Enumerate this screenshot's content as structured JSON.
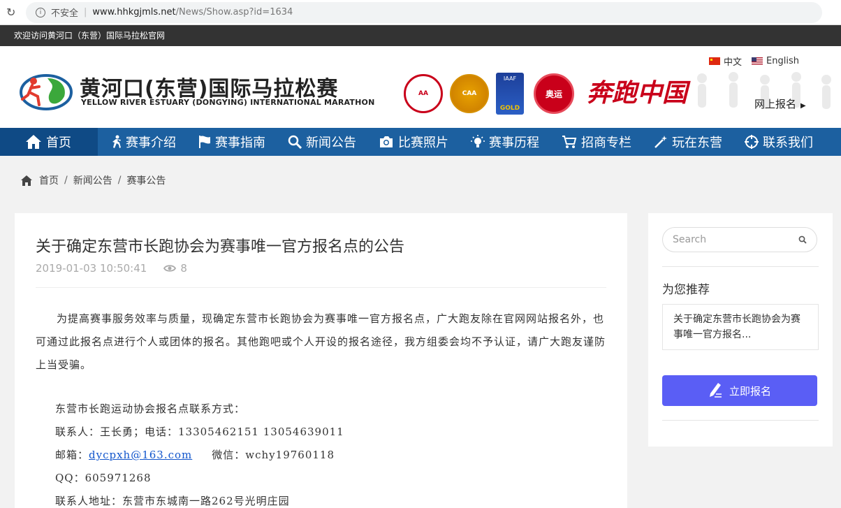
{
  "browser": {
    "security_label": "不安全",
    "url_host": "www.hhkgjmls.net",
    "url_path": "/News/Show.asp?id=1634"
  },
  "top_strip": {
    "welcome": "欢迎访问黄河口（东营）国际马拉松官网"
  },
  "header": {
    "logo_cn": "黄河口(东营)国际马拉松赛",
    "logo_en": "YELLOW RIVER ESTUARY (DONGYING) INTERNATIONAL MARATHON",
    "badge_caa": "CAA",
    "badge_aa": "AA",
    "badge_iaaf_top": "IAAF",
    "badge_iaaf_bottom": "GOLD",
    "badge_run": "奥运",
    "slogan": "奔跑中国",
    "lang_cn": "中文",
    "lang_en": "English",
    "signup": "网上报名"
  },
  "nav": {
    "items": [
      {
        "label": "首页"
      },
      {
        "label": "赛事介绍"
      },
      {
        "label": "赛事指南"
      },
      {
        "label": "新闻公告"
      },
      {
        "label": "比赛照片"
      },
      {
        "label": "赛事历程"
      },
      {
        "label": "招商专栏"
      },
      {
        "label": "玩在东营"
      },
      {
        "label": "联系我们"
      }
    ]
  },
  "breadcrumb": [
    "首页",
    "新闻公告",
    "赛事公告"
  ],
  "article": {
    "title": "关于确定东营市长跑协会为赛事唯一官方报名点的公告",
    "date": "2019-01-03 10:50:41",
    "views": "8",
    "paragraph": "为提高赛事服务效率与质量，现确定东营市长跑协会为赛事唯一官方报名点，广大跑友除在官网网站报名外，也可通过此报名点进行个人或团体的报名。其他跑吧或个人开设的报名途径，我方组委会均不予认证，请广大跑友谨防上当受骗。",
    "contact_heading": "东营市长跑运动协会报名点联系方式：",
    "contact_person": "联系人：王长勇；电话：13305462151  13054639011",
    "email_label": "邮箱：",
    "email": "dycpxh@163.com",
    "wechat": "微信：wchy19760118",
    "qq": "QQ：605971268",
    "address": "联系人地址：东营市东城南一路262号光明庄园"
  },
  "sidebar": {
    "search_placeholder": "Search",
    "rec_title": "为您推荐",
    "rec_item": "关于确定东营市长跑协会为赛事唯一官方报名...",
    "register_button": "立即报名"
  }
}
